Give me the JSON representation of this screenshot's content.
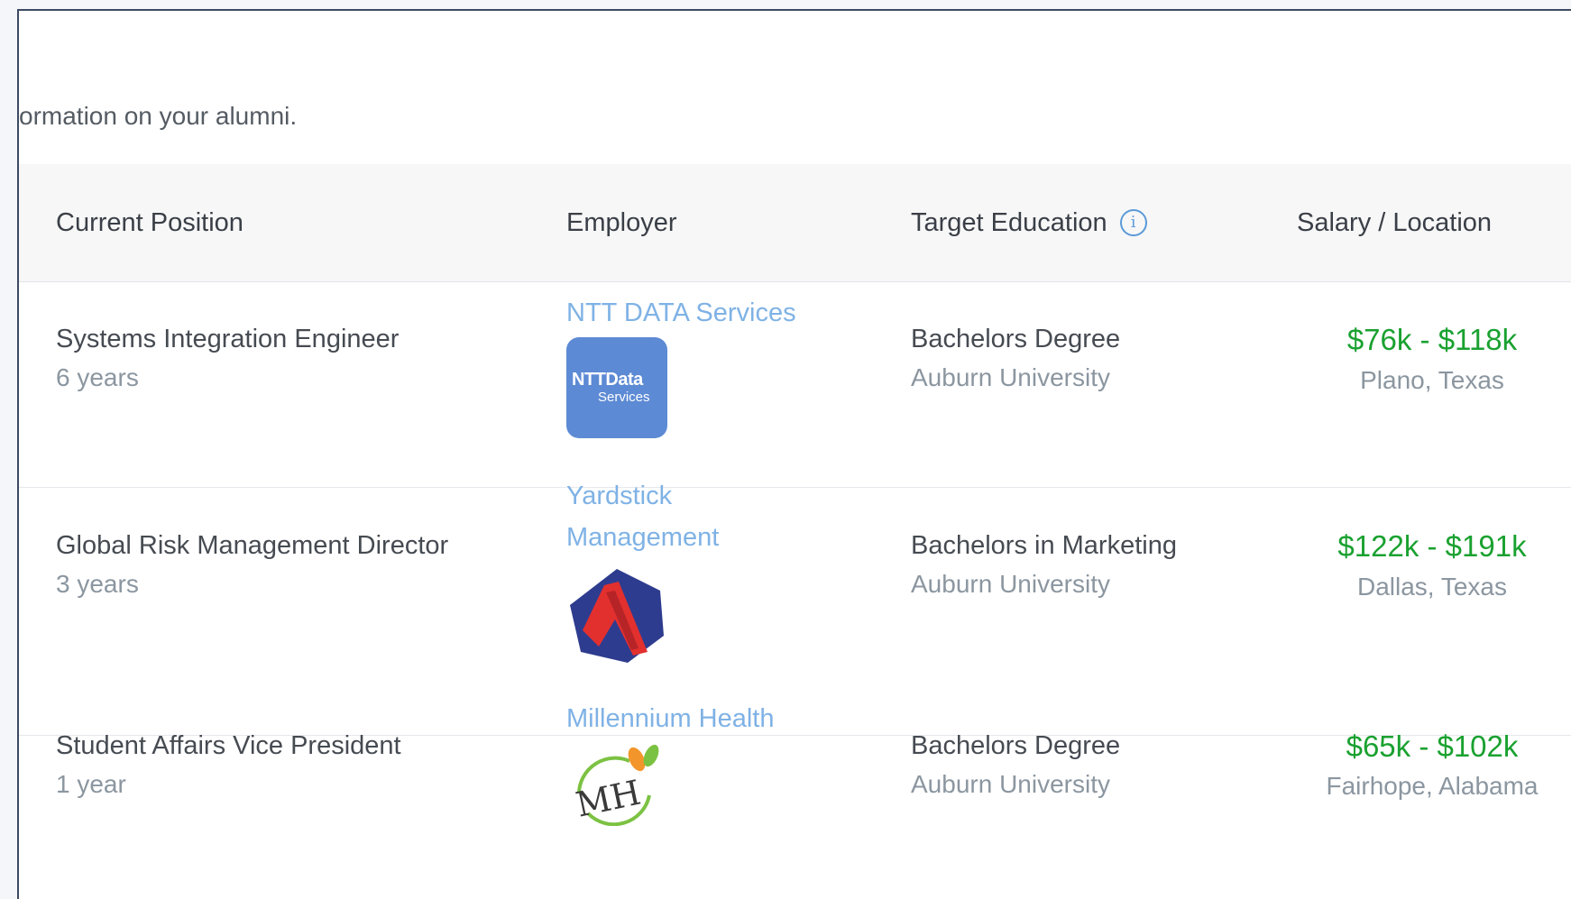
{
  "intro_text": "ormation on your alumni.",
  "table": {
    "headers": {
      "position": "Current Position",
      "employer": "Employer",
      "education": "Target Education",
      "salary_location": "Salary / Location"
    },
    "rows": [
      {
        "position": "Systems Integration Engineer",
        "years": "6 years",
        "employer": "NTT DATA Services",
        "logo_text_1": "NTTData",
        "logo_text_2": "Services",
        "degree": "Bachelors Degree",
        "school": "Auburn University",
        "salary": "$76k - $118k",
        "location": "Plano, Texas"
      },
      {
        "position": "Global Risk Management Director",
        "years": "3 years",
        "employer_line1": "Yardstick",
        "employer_line2": "Management",
        "degree": "Bachelors in Marketing",
        "school": "Auburn University",
        "salary": "$122k - $191k",
        "location": "Dallas, Texas"
      },
      {
        "position": "Student Affairs Vice President",
        "years": "1 year",
        "employer": "Millennium Health",
        "logo_text": "MH",
        "degree": "Bachelors Degree",
        "school": "Auburn University",
        "salary": "$65k - $102k",
        "location": "Fairhope, Alabama"
      }
    ]
  },
  "colors": {
    "link": "#7fb2e5",
    "salary": "#1aa130",
    "muted": "#8b96a0",
    "header_bg": "#f7f7f7"
  },
  "icons": {
    "info": "info-circle-icon"
  }
}
